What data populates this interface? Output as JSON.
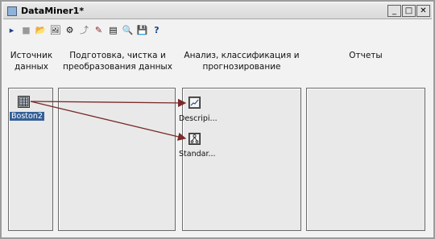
{
  "window": {
    "title": "DataMiner1*",
    "controls": {
      "minimize": "_",
      "maximize": "□",
      "close": "✕"
    }
  },
  "toolbar": {
    "items": [
      {
        "name": "run-step-icon",
        "glyph": "▸"
      },
      {
        "name": "stop-icon",
        "glyph": "■"
      },
      {
        "name": "open-folder-icon",
        "glyph": "📂"
      },
      {
        "name": "image-view-icon",
        "glyph": "🖼"
      },
      {
        "name": "tree-options-icon",
        "glyph": "⚙"
      },
      {
        "name": "link-tool-icon",
        "glyph": "⤴"
      },
      {
        "name": "annotate-icon",
        "glyph": "✎"
      },
      {
        "name": "bookmark-icon",
        "glyph": "▤"
      },
      {
        "name": "zoom-icon",
        "glyph": "🔍"
      },
      {
        "name": "save-icon",
        "glyph": "💾"
      },
      {
        "name": "help-icon",
        "glyph": "?"
      }
    ]
  },
  "columns": [
    {
      "id": "source",
      "header": "Источник\nданных"
    },
    {
      "id": "prep",
      "header": "Подготовка, чистка и\nпреобразования данных"
    },
    {
      "id": "analysis",
      "header": "Анализ, классификация и\nпрогнозирование"
    },
    {
      "id": "reports",
      "header": "Отчеты"
    }
  ],
  "nodes": {
    "source": {
      "label": "Boston2",
      "icon": "data-table-icon"
    },
    "descriptive": {
      "label": "Descripi...",
      "icon": "chart-icon"
    },
    "standard": {
      "label": "Standar...",
      "icon": "tree-model-icon"
    }
  },
  "colors": {
    "link": "#7a2a2a",
    "selection": "#335f96"
  }
}
